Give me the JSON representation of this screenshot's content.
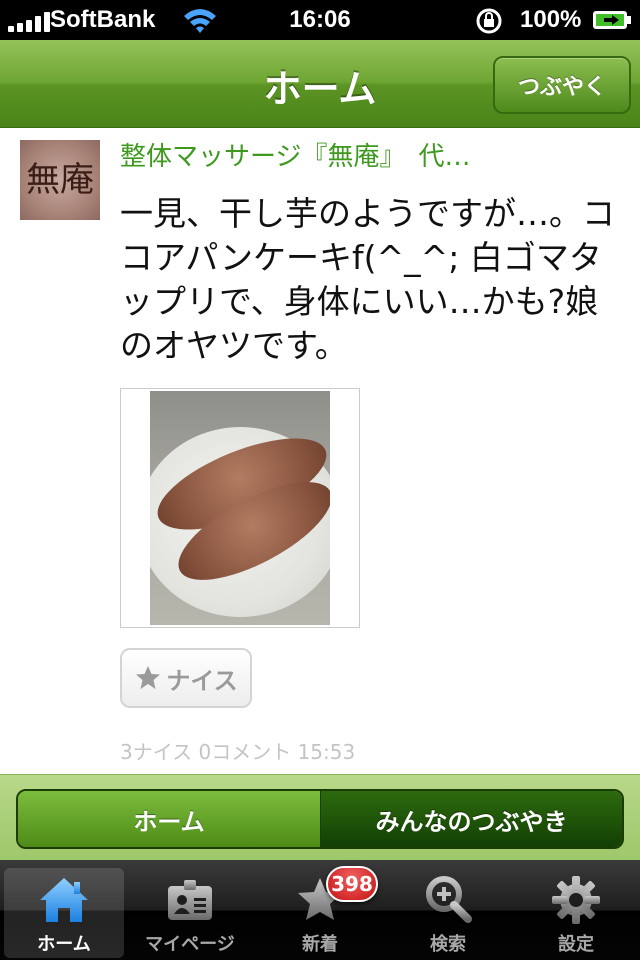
{
  "status_bar": {
    "carrier": "SoftBank",
    "time": "16:06",
    "battery_percent": "100%",
    "signal_bars": 5
  },
  "nav": {
    "title": "ホーム",
    "tweet_button": "つぶやく"
  },
  "post": {
    "author": "整体マッサージ『無庵』　代…",
    "avatar_glyph": "無庵",
    "text": "一見、干し芋のようですが…。ココアパンケーキf(^_^; 白ゴマタップリで、身体にいい…かも?娘のオヤツです。",
    "nice_button": "ナイス",
    "meta": "3ナイス 0コメント 15:53"
  },
  "segment": {
    "home": "ホーム",
    "everyone": "みんなのつぶやき",
    "selected": "home"
  },
  "tab_bar": {
    "tabs": [
      {
        "label": "ホーム",
        "icon": "home-icon",
        "active": true
      },
      {
        "label": "マイページ",
        "icon": "profile-card-icon",
        "active": false
      },
      {
        "label": "新着",
        "icon": "new-star-icon",
        "active": false
      },
      {
        "label": "検索",
        "icon": "search-zoom-icon",
        "active": false
      },
      {
        "label": "設定",
        "icon": "gear-icon",
        "active": false
      }
    ],
    "new_badge": "398"
  },
  "colors": {
    "nav_green": "#6fa633",
    "author_green": "#3d9a1e",
    "active_tab_blue": "#4aa3ff",
    "badge_red": "#d21c1c"
  }
}
